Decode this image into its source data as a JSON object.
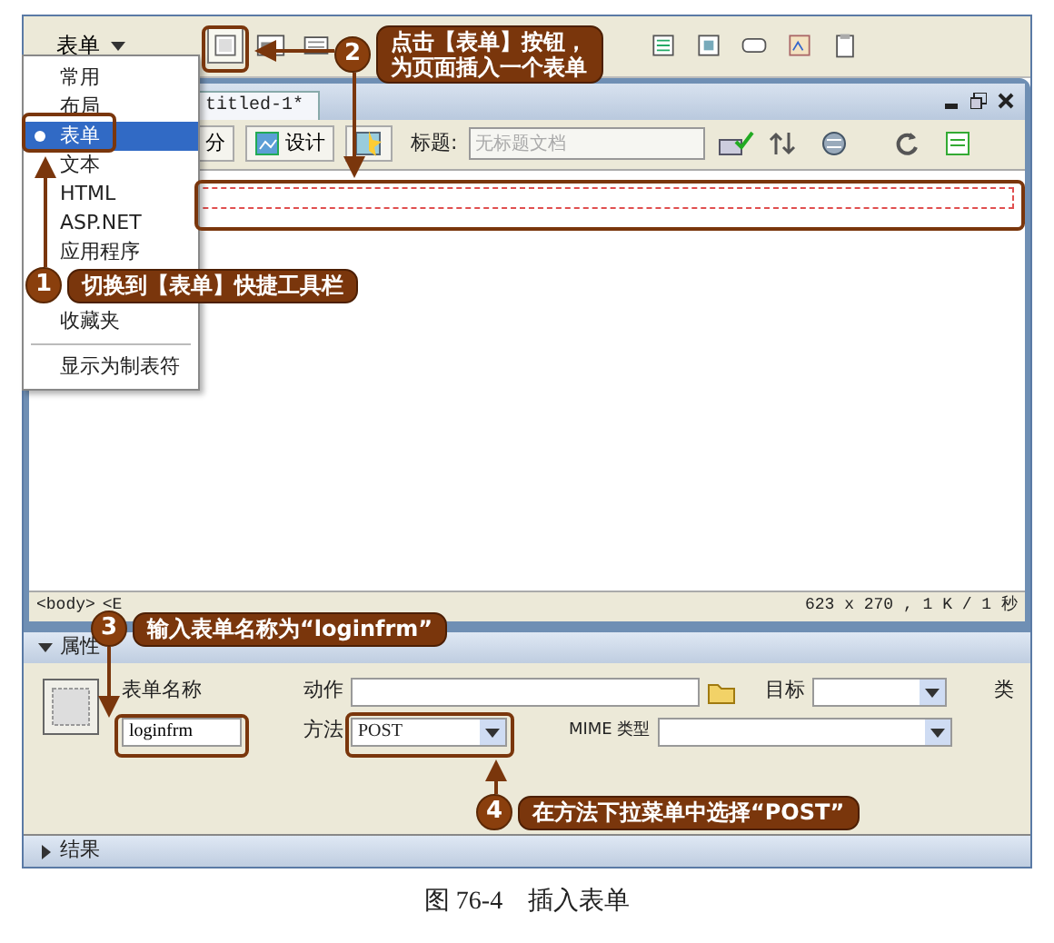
{
  "insert_bar": {
    "category": "表单"
  },
  "category_menu": {
    "items": [
      {
        "label": "常用",
        "selected": false
      },
      {
        "label": "布局",
        "selected": false
      },
      {
        "label": "表单",
        "selected": true
      },
      {
        "label": "文本",
        "selected": false
      },
      {
        "label": "HTML",
        "selected": false
      },
      {
        "label": "ASP.NET",
        "selected": false
      },
      {
        "label": "应用程序",
        "selected": false
      },
      {
        "label": "收藏夹",
        "selected": false
      }
    ],
    "footer": "显示为制表符"
  },
  "document": {
    "tab": "titled-1*",
    "toolbar": {
      "split": "分",
      "design": "设计",
      "title_label": "标题:",
      "title_value": "无标题文档"
    },
    "tag_selector": [
      "<body>",
      "<E"
    ],
    "status": "623 x 270 , 1 K / 1 秒"
  },
  "properties": {
    "title": "属性",
    "expanded": true,
    "form_name_label": "表单名称",
    "form_name": "loginfrm",
    "action_label": "动作",
    "target_label": "目标",
    "class_label": "类",
    "method_label": "方法",
    "method": "POST",
    "mime_label": "MIME 类型"
  },
  "results": {
    "title": "结果",
    "expanded": false
  },
  "callouts": [
    {
      "number": "1",
      "text": "切换到【表单】快捷工具栏"
    },
    {
      "number": "2",
      "text": "点击【表单】按钮，为页面插入一个表单"
    },
    {
      "number": "3",
      "text": "输入表单名称为“loginfrm”"
    },
    {
      "number": "4",
      "text": "在方法下拉菜单中选择“POST”"
    }
  ],
  "caption": {
    "figure": "图 76-4",
    "title": "插入表单"
  }
}
